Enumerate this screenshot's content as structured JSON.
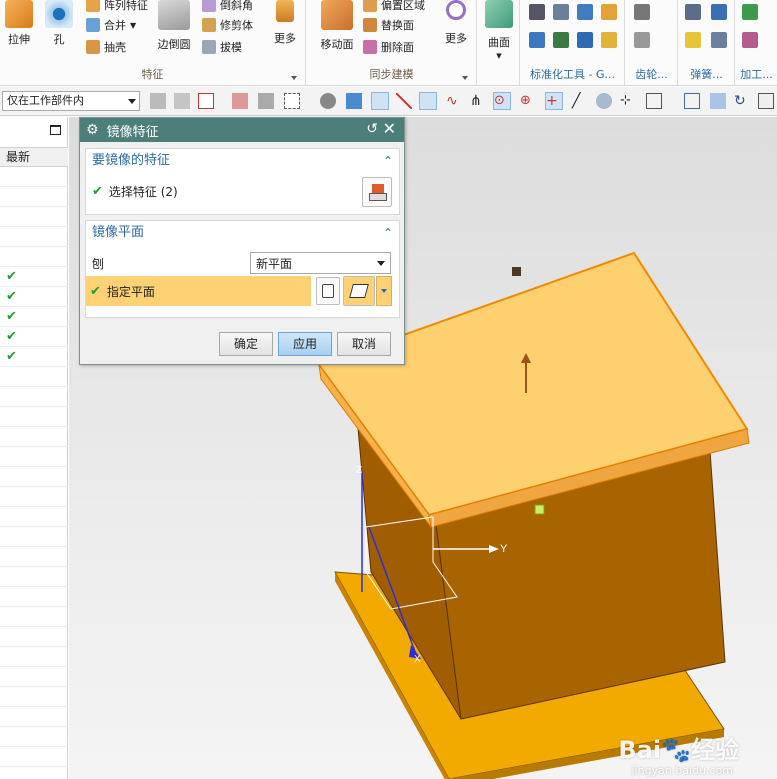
{
  "ribbon": {
    "feature_group": {
      "label": "特征",
      "extrude_label": "拉伸",
      "hole_label": "孔",
      "pattern_label": "阵列特征",
      "unite_label": "合并",
      "shell_label": "抽壳",
      "edge_blend_label": "边倒圆",
      "chamfer_label": "倒斜角",
      "trim_body_label": "修剪体",
      "draft_label": "拔模",
      "more_label": "更多"
    },
    "sync_group": {
      "label": "同步建模",
      "move_face_label": "移动面",
      "offset_region_label": "偏置区域",
      "replace_face_label": "替换面",
      "delete_face_label": "删除面",
      "more_label": "更多"
    },
    "surface_label": "曲面",
    "standard_tools_label": "标准化工具 - G...",
    "gear_label": "齿轮...",
    "spring_label": "弹簧...",
    "machining_label": "加工..."
  },
  "toolbar": {
    "filter_value": "仅在工作部件内"
  },
  "navigator": {
    "column_header": "最新",
    "checks": [
      "✔",
      "✔",
      "✔",
      "✔",
      "✔"
    ]
  },
  "dialog": {
    "title": "镜像特征",
    "section1_title": "要镜像的特征",
    "select_feature_label": "选择特征 (2)",
    "section2_title": "镜像平面",
    "plane_label": "刨",
    "plane_value": "新平面",
    "specify_plane_label": "指定平面",
    "ok_label": "确定",
    "apply_label": "应用",
    "cancel_label": "取消"
  },
  "viewport": {
    "axis_y_label": "Y",
    "axis_z_label": "Z",
    "axis_x_label": "X"
  },
  "watermark": {
    "brand_left": "Bai",
    "brand_paw": "🐾",
    "brand_right": "经验",
    "url": "jingyan.baidu.com"
  }
}
